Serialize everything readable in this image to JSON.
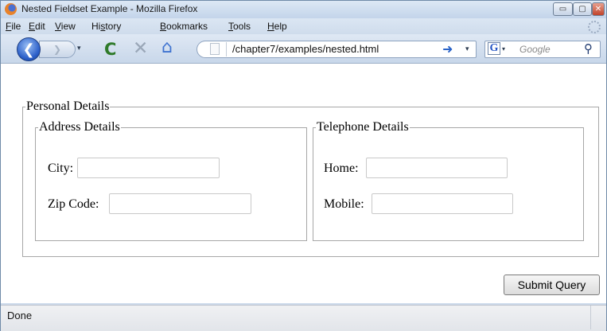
{
  "window": {
    "title": "Nested Fieldset Example - Mozilla Firefox",
    "controls": {
      "minimize": "▭",
      "maximize": "▢",
      "close": "✕"
    }
  },
  "menu": {
    "items": [
      {
        "key": "F",
        "rest": "ile"
      },
      {
        "key": "E",
        "rest": "dit"
      },
      {
        "key": "V",
        "rest": "iew"
      },
      {
        "pre": "Hi",
        "key": "s",
        "rest": "tory"
      },
      {
        "key": "B",
        "rest": "ookmarks"
      },
      {
        "key": "T",
        "rest": "ools"
      },
      {
        "key": "H",
        "rest": "elp"
      }
    ]
  },
  "toolbar": {
    "back_icon": "❮",
    "forward_icon": "❯",
    "dropdown_glyph": "▾",
    "reload_icon": "C",
    "stop_icon": "✕",
    "home_icon": "⌂",
    "url": "/chapter7/examples/nested.html",
    "go_icon": "➜",
    "search_engine_glyph": "G",
    "search_placeholder": "Google",
    "search_icon": "⚲"
  },
  "form": {
    "outer_legend": "Personal Details",
    "address_legend": "Address Details",
    "telephone_legend": "Telephone Details",
    "city_label": "City:",
    "zip_label": "Zip Code:",
    "home_label": "Home:",
    "mobile_label": "Mobile:",
    "city_value": "",
    "zip_value": "",
    "home_value": "",
    "mobile_value": "",
    "submit_label": "Submit Query"
  },
  "status": {
    "text": "Done"
  }
}
